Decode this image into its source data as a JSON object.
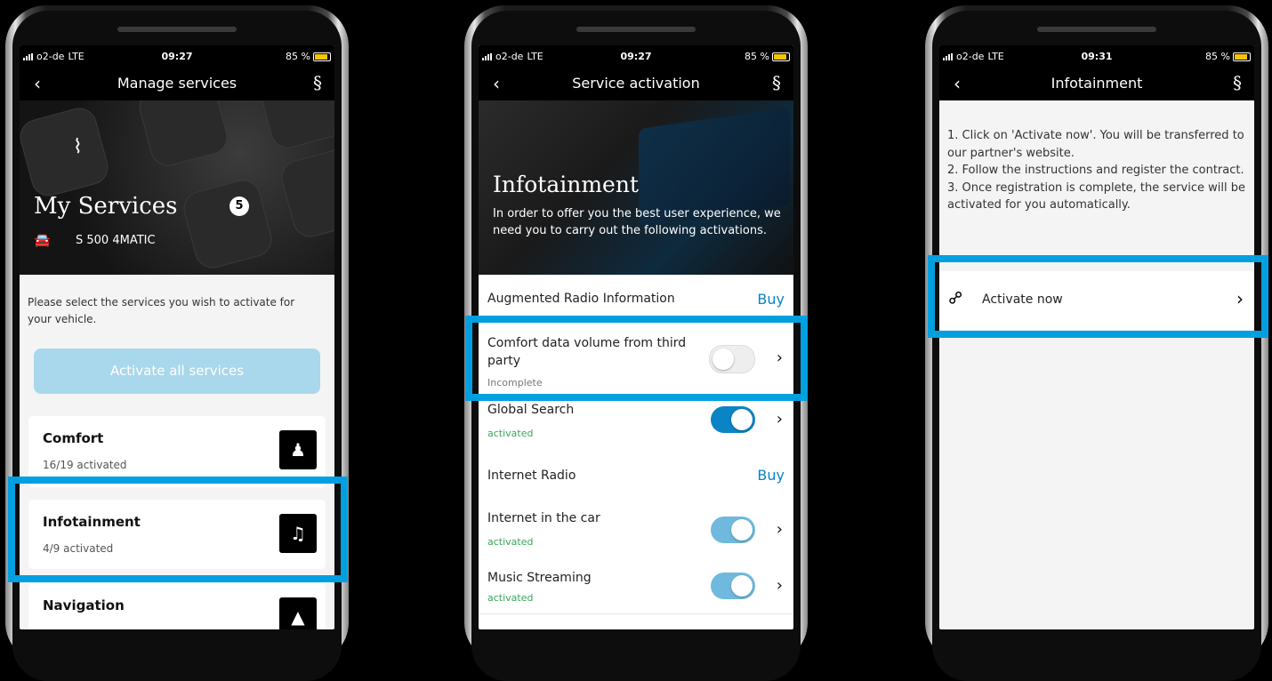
{
  "status": {
    "carrier": "o2-de",
    "network": "LTE",
    "battery": "85 %",
    "times": [
      "09:27",
      "09:27",
      "09:31"
    ]
  },
  "phone1": {
    "title": "Manage services",
    "hero_title": "My Services",
    "vehicle": "S 500 4MATIC",
    "instruction": "Please select the services you wish to activate for your vehicle.",
    "activate_all": "Activate all services",
    "services": [
      {
        "name": "Comfort",
        "status": "16/19 activated",
        "icon": "seat-icon"
      },
      {
        "name": "Infotainment",
        "status": "4/9 activated",
        "icon": "music-note-icon"
      },
      {
        "name": "Navigation",
        "status": "",
        "icon": "navigation-arrow-icon"
      }
    ]
  },
  "phone2": {
    "title": "Service activation",
    "hero_title": "Infotainment",
    "hero_text": "In order to offer you the best user experience, we need you to carry out the following activations.",
    "items": [
      {
        "name": "Augmented Radio Information",
        "action": "Buy"
      },
      {
        "name": "Comfort data volume from third party",
        "status": "Incomplete",
        "toggle": "off"
      },
      {
        "name": "Global Search",
        "status": "activated",
        "toggle": "on"
      },
      {
        "name": "Internet Radio",
        "action": "Buy"
      },
      {
        "name": "Internet in the car",
        "status": "activated",
        "toggle": "on"
      },
      {
        "name": "Music Streaming",
        "status": "activated",
        "toggle": "on"
      }
    ],
    "colors": {
      "accent": "#0a84c4",
      "toggle_on": "#0a84c4",
      "activated": "#3aa657"
    }
  },
  "phone3": {
    "title": "Infotainment",
    "steps": "1. Click on 'Activate now'. You will be transferred to our partner's website.\n2. Follow the instructions and register the contract.\n3. Once registration is complete, the service will be activated for you automatically.",
    "activate_now": "Activate now"
  },
  "highlight_color": "#00a0e0"
}
